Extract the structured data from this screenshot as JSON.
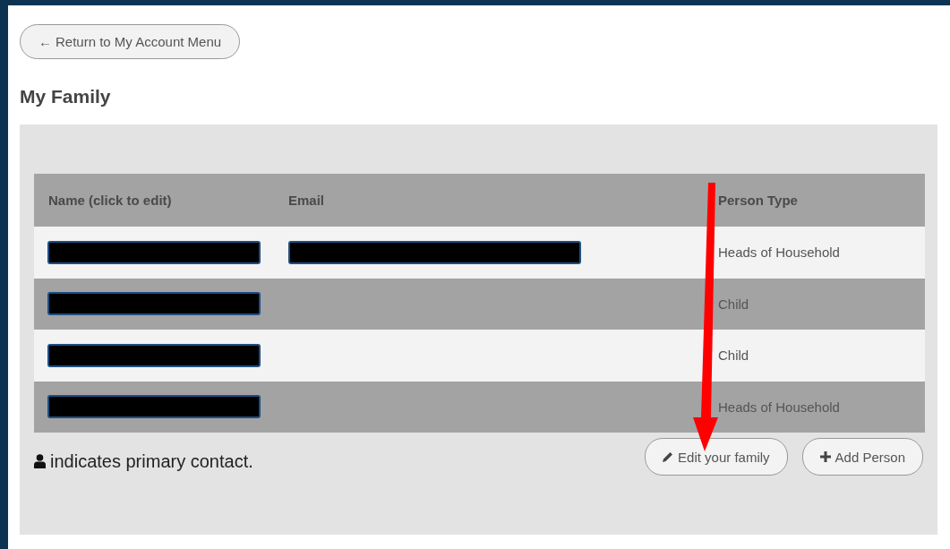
{
  "back_button": {
    "icon": "←",
    "label": "Return to My Account Menu"
  },
  "title": "My Family",
  "table": {
    "columns": [
      "Name (click to edit)",
      "Email",
      "Person Type"
    ],
    "rows": [
      {
        "name_redacted": true,
        "email_redacted": true,
        "person_type": "Heads of Household"
      },
      {
        "name_redacted": true,
        "email_redacted": false,
        "person_type": "Child"
      },
      {
        "name_redacted": true,
        "email_redacted": false,
        "person_type": "Child"
      },
      {
        "name_redacted": true,
        "email_redacted": false,
        "person_type": "Heads of Household"
      }
    ]
  },
  "legend": "indicates primary contact.",
  "buttons": [
    {
      "kind": "edit",
      "label": "Edit your family"
    },
    {
      "kind": "add",
      "label": "Add Person"
    }
  ]
}
